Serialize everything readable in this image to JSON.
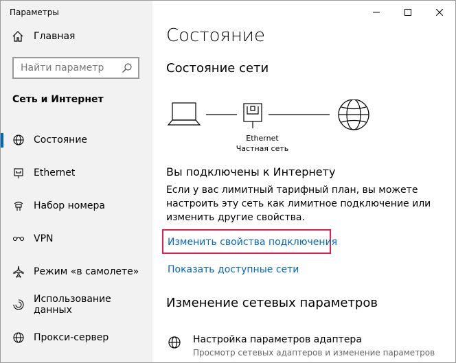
{
  "window": {
    "title": "Параметры"
  },
  "sidebar": {
    "home_label": "Главная",
    "search_placeholder": "Найти параметр",
    "section_title": "Сеть и Интернет",
    "items": [
      {
        "label": "Состояние",
        "icon": "globe-icon",
        "active": true
      },
      {
        "label": "Ethernet",
        "icon": "ethernet-icon"
      },
      {
        "label": "Набор номера",
        "icon": "dialup-icon"
      },
      {
        "label": "VPN",
        "icon": "vpn-icon"
      },
      {
        "label": "Режим «в самолете»",
        "icon": "airplane-icon"
      },
      {
        "label": "Использование данных",
        "icon": "data-usage-icon"
      },
      {
        "label": "Прокси-сервер",
        "icon": "globe-icon"
      }
    ]
  },
  "main": {
    "title": "Состояние",
    "status_heading": "Состояние сети",
    "diagram": {
      "adapter_name": "Ethernet",
      "network_name": "Частная сеть"
    },
    "connected_text": "Вы подключены к Интернету",
    "description": "Если у вас лимитный тарифный план, вы можете настроить эту сеть как лимитное подключение или изменить другие свойства.",
    "change_link": "Изменить свойства подключения",
    "show_networks_link": "Показать доступные сети",
    "change_heading": "Изменение сетевых параметров",
    "adapter_settings": {
      "title": "Настройка параметров адаптера",
      "subtitle": "Просмотр сетевых адаптеров и изменение параметров"
    }
  },
  "colors": {
    "accent": "#0067c0",
    "highlight": "#e81e50",
    "sidebar_bg": "#f2f2f2"
  }
}
